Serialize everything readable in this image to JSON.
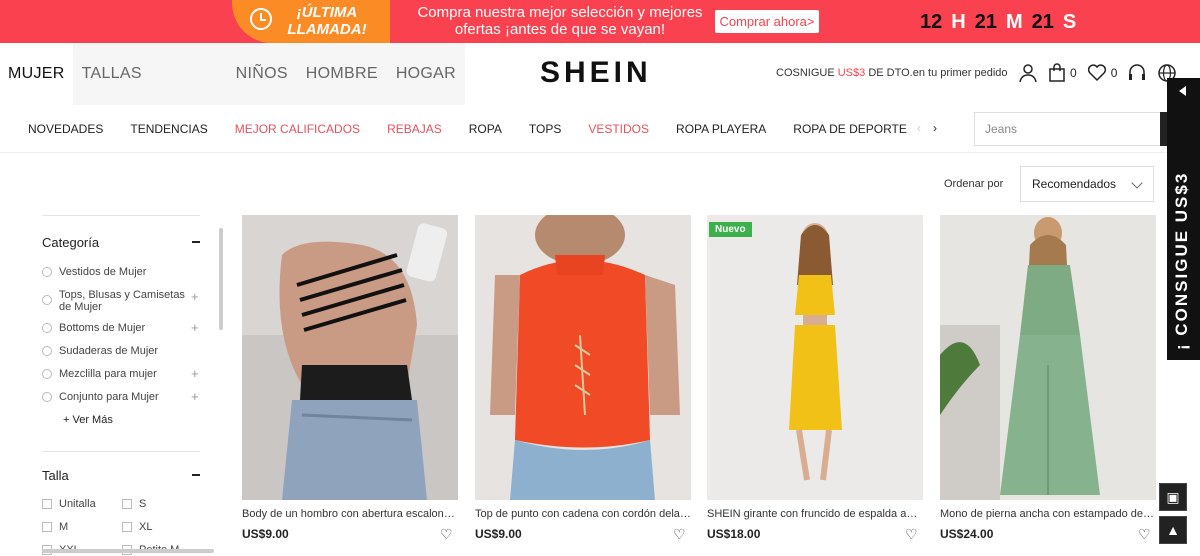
{
  "promo": {
    "burst": "¡ÚLTIMA LLAMADA!",
    "message": "Compra nuestra mejor selección y mejores ofertas ¡antes de que se vayan!",
    "cta": "Comprar ahora>",
    "timer": {
      "hours": "12",
      "h": "H",
      "minutes": "21",
      "m": "M",
      "seconds": "21",
      "s": "S"
    }
  },
  "header": {
    "categories": [
      "MUJER",
      "TALLAS GRANDES",
      "NIÑOS",
      "HOMBRE",
      "HOGAR"
    ],
    "logo": "SHEIN",
    "promo_prefix": "COSNIGUE ",
    "promo_amount": "US$3",
    "promo_suffix": " DE DTO.en tu primer pedido",
    "cart_count": "0",
    "wish_count": "0"
  },
  "subnav": {
    "links": [
      "NOVEDADES",
      "TENDENCIAS",
      "MEJOR CALIFICADOS",
      "REBAJAS",
      "ROPA",
      "TOPS",
      "VESTIDOS",
      "ROPA PLAYERA",
      "ROPA DE DEPORTE"
    ],
    "hot": [
      false,
      false,
      true,
      true,
      false,
      false,
      true,
      false,
      false
    ],
    "search_placeholder": "Jeans"
  },
  "sort": {
    "label": "Ordenar por",
    "value": "Recomendados"
  },
  "sidebar": {
    "category_title": "Categoría",
    "categories": [
      "Vestidos de Mujer",
      "Tops, Blusas y Camisetas de Mujer",
      "Bottoms de Mujer",
      "Sudaderas de Mujer",
      "Mezclilla para mujer",
      "Conjunto para Mujer"
    ],
    "more": "+ Ver Más",
    "size_title": "Talla",
    "sizes": [
      "Unitalla",
      "S",
      "M",
      "XL",
      "XXL",
      "Petite M"
    ]
  },
  "products": [
    {
      "name": "Body de un hombro con abertura escalonada",
      "price": "US$9.00",
      "badge": ""
    },
    {
      "name": "Top de punto con cadena con cordón delantero",
      "price": "US$9.00",
      "badge": ""
    },
    {
      "name": "SHEIN girante con fruncido de espalda abierta",
      "price": "US$18.00",
      "badge": "Nuevo"
    },
    {
      "name": "Mono de pierna ancha con estampado de lunares",
      "price": "US$24.00",
      "badge": ""
    }
  ],
  "side_promo": "¡ CONSIGUE US$3",
  "colors": {
    "banner": "#f9414f",
    "burst": "#fb8b24",
    "hot": "#e4515d",
    "badge": "#3cb04a"
  }
}
